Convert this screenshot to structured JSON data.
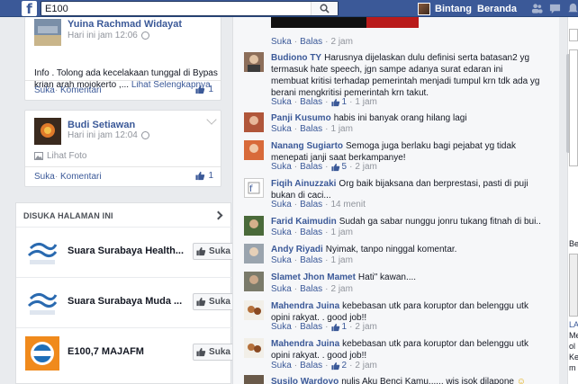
{
  "topbar": {
    "logo": "f",
    "search_value": "E100",
    "profile_name": "Bintang",
    "home_label": "Beranda"
  },
  "posts": [
    {
      "author": "Yuina Rachmad Widayat",
      "time": "Hari ini jam 12:06",
      "text": "Info . Tolong ada kecelakaan tunggal di Bypas krian arah mojokerto ,...",
      "see_more": "Lihat Selengkapnya",
      "like_label": "Suka",
      "comment_label": "Komentari",
      "like_count": "1"
    },
    {
      "author": "Budi Setiawan",
      "time": "Hari ini jam 12:04",
      "photo_label": "Lihat Foto",
      "like_label": "Suka",
      "comment_label": "Komentari",
      "like_count": "1"
    }
  ],
  "liked_pages": {
    "heading": "DISUKA HALAMAN INI",
    "button_label": "Suka",
    "items": [
      {
        "name": "Suara Surabaya Health..."
      },
      {
        "name": "Suara Surabaya Muda ..."
      },
      {
        "name": "E100,7 MAJAFM"
      }
    ]
  },
  "comments": {
    "like_label": "Suka",
    "reply_label": "Balas",
    "items": [
      {
        "name": "",
        "text": "",
        "likes": "",
        "time": "2 jam"
      },
      {
        "name": "Budiono TY",
        "text": "Harusnya dijelaskan dulu definisi serta batasan2 yg termasuk hate speech, jgn sampe adanya surat edaran ini membuat kritisi terhadap pemerintah menjadi tumpul krn tdk ada yg berani mengkritisi pemerintah krn takut.",
        "likes": "1",
        "time": "1 jam"
      },
      {
        "name": "Panji Kusumo",
        "text": "habis ini banyak orang hilang lagi",
        "likes": "",
        "time": "1 jam"
      },
      {
        "name": "Nanang Sugiarto",
        "text": "Semoga juga berlaku bagi pejabat yg tidak menepati janji saat berkampanye!",
        "likes": "5",
        "time": "2 jam"
      },
      {
        "name": "Fiqih Ainuzzaki",
        "text": "Org baik bijaksana dan berprestasi, pasti di puji bukan di caci...",
        "likes": "",
        "time": "14 menit"
      },
      {
        "name": "Farid Kaimudin",
        "text": "Sudah ga sabar nunggu jonru tukang fitnah di bui..",
        "likes": "",
        "time": "1 jam"
      },
      {
        "name": "Andy Riyadi",
        "text": "Nyimak, tanpo ninggal komentar.",
        "likes": "",
        "time": "1 jam"
      },
      {
        "name": "Slamet Jhon Mamet",
        "text": "Hati\" kawan....",
        "likes": "",
        "time": "2 jam"
      },
      {
        "name": "Mahendra Juina",
        "text": "kebebasan utk para koruptor dan belenggu utk opini rakyat. . good job!!",
        "likes": "1",
        "time": "2 jam"
      },
      {
        "name": "Mahendra Juina",
        "text": "kebebasan utk para koruptor dan belenggu utk opini rakyat. . good job!!",
        "likes": "2",
        "time": "2 jam"
      },
      {
        "name": "Susilo Wardoyo",
        "text": "nulis Aku Benci Kamu...... wis isok dilapone",
        "likes": "",
        "time": ""
      }
    ]
  },
  "right_rail": {
    "labels": [
      "Be",
      "LA",
      "Me",
      "ol",
      "Ke",
      "m"
    ]
  },
  "colors": {
    "brand": "#3b5998",
    "link": "#3b5998",
    "muted": "#90949c",
    "page_bg": "#e9ebee"
  }
}
